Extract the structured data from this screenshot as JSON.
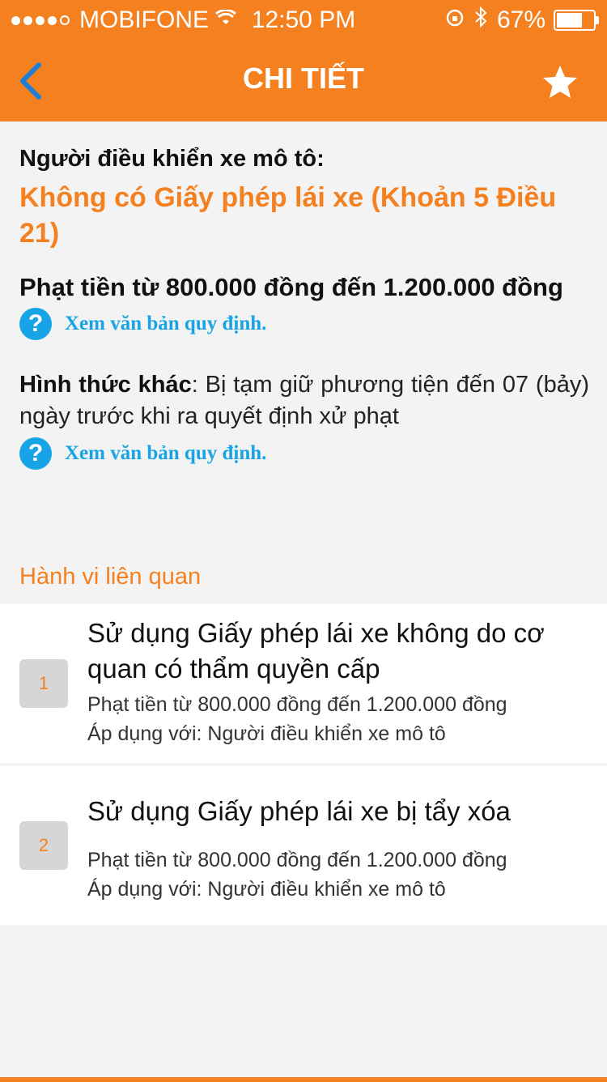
{
  "status_bar": {
    "carrier": "MOBIFONE",
    "time": "12:50 PM",
    "battery_percent": "67%",
    "battery_level": 0.67,
    "icons": [
      "signal-icon",
      "wifi-icon",
      "rotation-lock-icon",
      "bluetooth-icon",
      "battery-icon"
    ]
  },
  "nav": {
    "title": "CHI TIẾT",
    "back_icon": "chevron-left-icon",
    "favorite_icon": "star-icon"
  },
  "detail": {
    "subject": "Người điều khiển xe mô tô:",
    "violation": "Không có Giấy phép lái xe (Khoản 5 Điều 21)",
    "fine": "Phạt tiền từ 800.000 đồng đến 1.200.000 đồng",
    "ref_link_1": "Xem văn bản quy định.",
    "other_label": "Hình thức khác",
    "other_text": ": Bị tạm giữ phương tiện đến 07 (bảy) ngày trước khi ra quyết định xử phạt",
    "ref_link_2": "Xem văn bản quy định."
  },
  "related": {
    "heading": "Hành vi liên quan",
    "items": [
      {
        "index": "1",
        "title": "Sử dụng Giấy phép lái xe không do cơ quan có thẩm quyền cấp",
        "fine": "Phạt tiền từ 800.000 đồng đến 1.200.000 đồng",
        "applies": "Áp dụng với: Người điều khiển xe mô tô"
      },
      {
        "index": "2",
        "title": "Sử dụng Giấy phép lái xe bị tẩy xóa",
        "fine": "Phạt tiền từ 800.000 đồng đến 1.200.000 đồng",
        "applies": "Áp dụng với: Người điều khiển xe mô tô"
      }
    ]
  },
  "colors": {
    "accent": "#f5801f",
    "link": "#16a4e6",
    "background": "#f3f3f3"
  }
}
